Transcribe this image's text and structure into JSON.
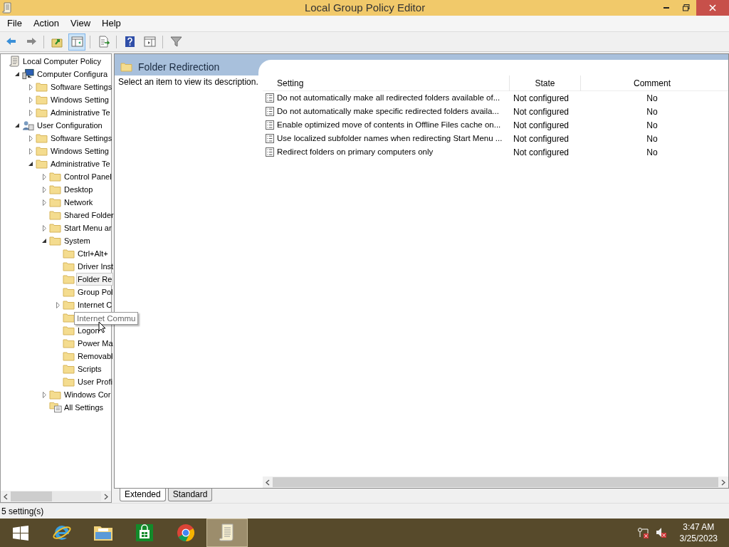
{
  "window": {
    "title": "Local Group Policy Editor"
  },
  "menu": [
    "File",
    "Action",
    "View",
    "Help"
  ],
  "toolbar": [
    {
      "kind": "back"
    },
    {
      "kind": "forward"
    },
    {
      "kind": "sep"
    },
    {
      "kind": "up",
      "pressed": false
    },
    {
      "kind": "tree",
      "pressed": true
    },
    {
      "kind": "sep"
    },
    {
      "kind": "export",
      "pressed": false
    },
    {
      "kind": "sep"
    },
    {
      "kind": "help",
      "pressed": false
    },
    {
      "kind": "panel",
      "pressed": false
    },
    {
      "kind": "sep"
    },
    {
      "kind": "filter",
      "pressed": false
    }
  ],
  "tree": [
    {
      "label": "Local Computer Policy",
      "kind": "policy",
      "selected": false,
      "children": [
        {
          "label": "Computer Configura",
          "kind": "computer",
          "selected": false,
          "expanded": true,
          "children": [
            {
              "label": "Software Settings",
              "kind": "folder",
              "selected": false,
              "expanded": false
            },
            {
              "label": "Windows Setting",
              "kind": "folder",
              "selected": false,
              "expanded": false
            },
            {
              "label": "Administrative Te",
              "kind": "folder",
              "selected": false,
              "expanded": false
            }
          ]
        },
        {
          "label": "User Configuration",
          "kind": "user",
          "selected": false,
          "expanded": true,
          "children": [
            {
              "label": "Software Settings",
              "kind": "folder",
              "selected": false,
              "expanded": false
            },
            {
              "label": "Windows Setting",
              "kind": "folder",
              "selected": false,
              "expanded": false
            },
            {
              "label": "Administrative Te",
              "kind": "folder",
              "selected": false,
              "expanded": true,
              "children": [
                {
                  "label": "Control Panel",
                  "kind": "folder",
                  "selected": false,
                  "expanded": false
                },
                {
                  "label": "Desktop",
                  "kind": "folder",
                  "selected": false,
                  "expanded": false
                },
                {
                  "label": "Network",
                  "kind": "folder",
                  "selected": false,
                  "expanded": false
                },
                {
                  "label": "Shared Folder",
                  "kind": "folder",
                  "selected": false
                },
                {
                  "label": "Start Menu ar",
                  "kind": "folder",
                  "selected": false,
                  "expanded": false
                },
                {
                  "label": "System",
                  "kind": "folder",
                  "selected": false,
                  "expanded": true,
                  "children": [
                    {
                      "label": "Ctrl+Alt+",
                      "kind": "folder",
                      "selected": false
                    },
                    {
                      "label": "Driver Inst",
                      "kind": "folder",
                      "selected": false
                    },
                    {
                      "label": "Folder Re",
                      "kind": "folder",
                      "selected": true
                    },
                    {
                      "label": "Group Pol",
                      "kind": "folder",
                      "selected": false
                    },
                    {
                      "label": "Internet C",
                      "kind": "folder",
                      "selected": false,
                      "expanded": false
                    },
                    {
                      "kind": "folder",
                      "selected": false,
                      "tooltip": "Internet Commu"
                    },
                    {
                      "label": "Logon",
                      "kind": "folder",
                      "selected": false
                    },
                    {
                      "label": "Power Ma",
                      "kind": "folder",
                      "selected": false
                    },
                    {
                      "label": "Removabl",
                      "kind": "folder",
                      "selected": false
                    },
                    {
                      "label": "Scripts",
                      "kind": "folder",
                      "selected": false
                    },
                    {
                      "label": "User Profi",
                      "kind": "folder",
                      "selected": false
                    }
                  ]
                },
                {
                  "label": "Windows Cor",
                  "kind": "folder",
                  "selected": false,
                  "expanded": false
                },
                {
                  "label": "All Settings",
                  "kind": "all-settings",
                  "selected": false
                }
              ]
            }
          ]
        }
      ]
    }
  ],
  "details": {
    "title": "Folder Redirection",
    "description": "Select an item to view its description.",
    "columns": [
      "Setting",
      "State",
      "Comment"
    ],
    "rows": [
      {
        "setting": "Do not automatically make all redirected folders available of...",
        "state": "Not configured",
        "comment": "No"
      },
      {
        "setting": "Do not automatically make specific redirected folders availa...",
        "state": "Not configured",
        "comment": "No"
      },
      {
        "setting": "Enable optimized move of contents in Offline Files cache on...",
        "state": "Not configured",
        "comment": "No"
      },
      {
        "setting": "Use localized subfolder names when redirecting Start Menu ...",
        "state": "Not configured",
        "comment": "No"
      },
      {
        "setting": "Redirect folders on primary computers only",
        "state": "Not configured",
        "comment": "No"
      }
    ]
  },
  "view_tabs": [
    {
      "label": "Extended",
      "selected": true
    },
    {
      "label": "Standard",
      "selected": false
    }
  ],
  "status_bar": "5 setting(s)",
  "taskbar": {
    "apps": [
      {
        "kind": "start",
        "active": false
      },
      {
        "kind": "ie",
        "active": false
      },
      {
        "kind": "explorer",
        "active": false
      },
      {
        "kind": "store",
        "active": false
      },
      {
        "kind": "chrome",
        "active": false
      },
      {
        "kind": "gpedit",
        "active": true
      }
    ],
    "time": "3:47 AM",
    "date": "3/25/2023"
  }
}
